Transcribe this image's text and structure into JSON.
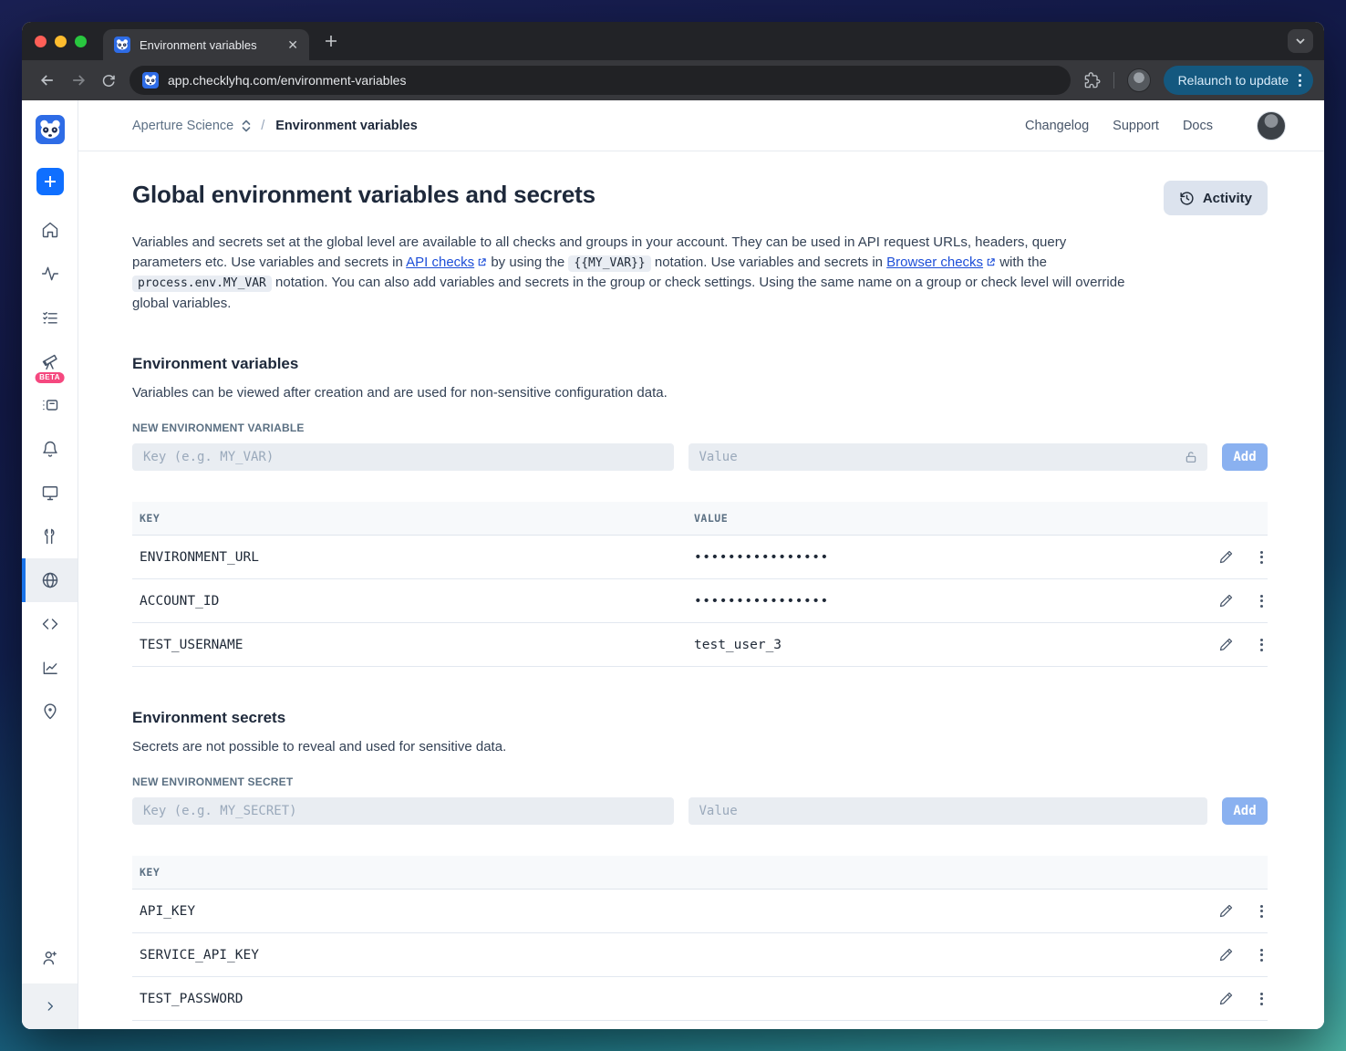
{
  "browser": {
    "tab_title": "Environment variables",
    "url": "app.checklyhq.com/environment-variables",
    "relaunch_label": "Relaunch to update"
  },
  "header": {
    "account": "Aperture Science",
    "separator": "/",
    "page": "Environment variables",
    "links": {
      "changelog": "Changelog",
      "support": "Support",
      "docs": "Docs"
    }
  },
  "sidebar": {
    "beta_badge": "BETA"
  },
  "main": {
    "title": "Global environment variables and secrets",
    "activity_label": "Activity",
    "intro": {
      "part1": "Variables and secrets set at the global level are available to all checks and groups in your account. They can be used in API request URLs, headers, query parameters etc. Use variables and secrets in ",
      "link1": "API checks",
      "part2": " by using the ",
      "code1": "{{MY_VAR}}",
      "part3": " notation. Use variables and secrets in ",
      "link2": "Browser checks",
      "part4": " with the ",
      "code2": "process.env.MY_VAR",
      "part5": " notation. You can also add variables and secrets in the group or check settings. Using the same name on a group or check level will override global variables."
    },
    "variables": {
      "heading": "Environment variables",
      "description": "Variables can be viewed after creation and are used for non-sensitive configuration data.",
      "form_label": "NEW ENVIRONMENT VARIABLE",
      "key_placeholder": "Key (e.g. MY_VAR)",
      "value_placeholder": "Value",
      "add_label": "Add",
      "columns": {
        "key": "KEY",
        "value": "VALUE"
      },
      "rows": [
        {
          "key": "ENVIRONMENT_URL",
          "value": "••••••••••••••••"
        },
        {
          "key": "ACCOUNT_ID",
          "value": "••••••••••••••••"
        },
        {
          "key": "TEST_USERNAME",
          "value": "test_user_3"
        }
      ]
    },
    "secrets": {
      "heading": "Environment secrets",
      "description": "Secrets are not possible to reveal and used for sensitive data.",
      "form_label": "NEW ENVIRONMENT SECRET",
      "key_placeholder": "Key (e.g. MY_SECRET)",
      "value_placeholder": "Value",
      "add_label": "Add",
      "columns": {
        "key": "KEY"
      },
      "rows": [
        {
          "key": "API_KEY"
        },
        {
          "key": "SERVICE_API_KEY"
        },
        {
          "key": "TEST_PASSWORD"
        }
      ]
    }
  },
  "colors": {
    "accent_blue": "#1a73e8",
    "add_button_blue": "#8ab1f0",
    "beta_pink": "#f5487f",
    "relaunch_blue": "#14587f",
    "active_item_bg": "#eceff3"
  }
}
